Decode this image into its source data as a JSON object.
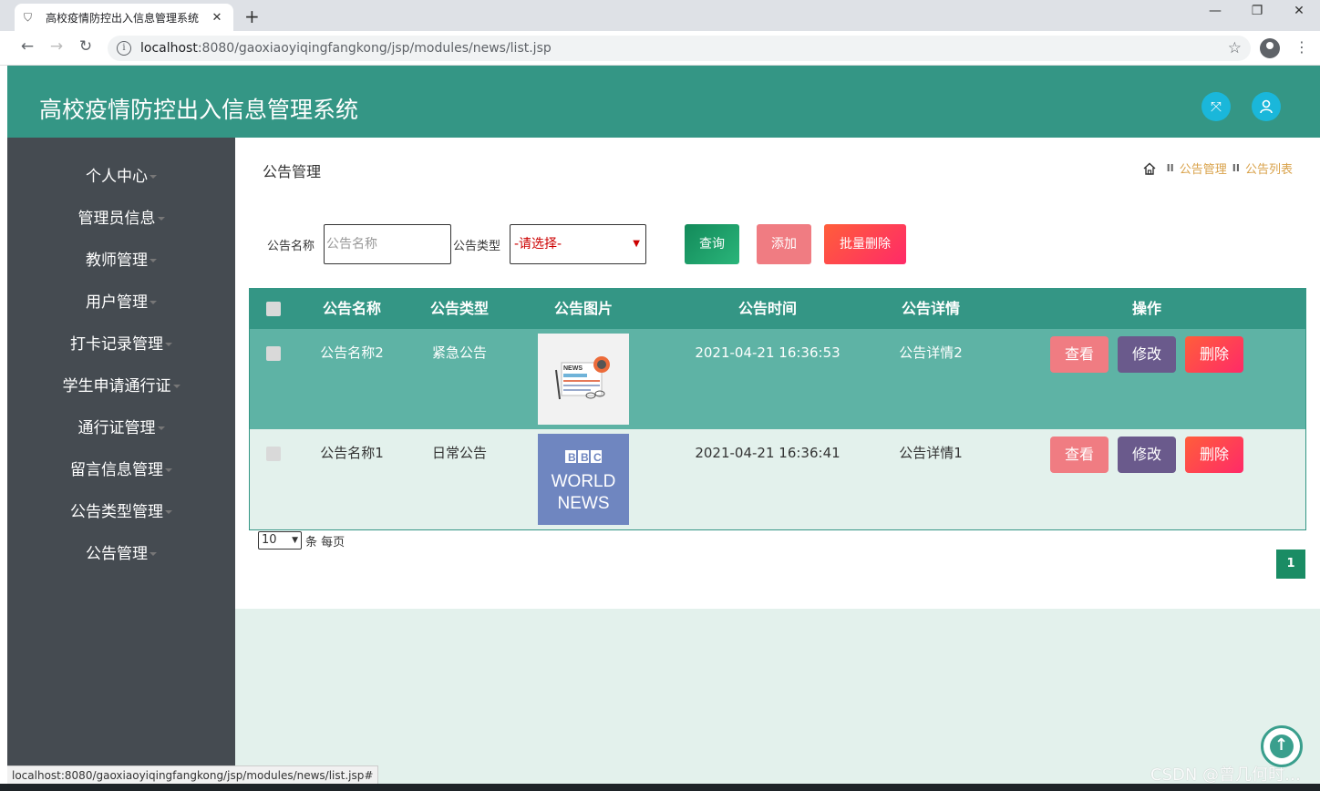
{
  "browser": {
    "tab_title": "高校疫情防控出入信息管理系统",
    "tab_close": "✕",
    "new_tab": "+",
    "url_host": "localhost",
    "url_path": ":8080/gaoxiaoyiqingfangkong/jsp/modules/news/list.jsp",
    "status_url": "localhost:8080/gaoxiaoyiqingfangkong/jsp/modules/news/list.jsp#"
  },
  "header": {
    "title": "高校疫情防控出入信息管理系统"
  },
  "sidebar": {
    "items": [
      {
        "label": "个人中心"
      },
      {
        "label": "管理员信息"
      },
      {
        "label": "教师管理"
      },
      {
        "label": "用户管理"
      },
      {
        "label": "打卡记录管理"
      },
      {
        "label": "学生申请通行证"
      },
      {
        "label": "通行证管理"
      },
      {
        "label": "留言信息管理"
      },
      {
        "label": "公告类型管理"
      },
      {
        "label": "公告管理"
      }
    ]
  },
  "page": {
    "title": "公告管理",
    "breadcrumb": [
      "公告管理",
      "公告列表"
    ],
    "breadcrumb_sep": "II"
  },
  "search": {
    "name_label": "公告名称",
    "name_placeholder": "公告名称",
    "type_label": "公告类型",
    "type_selected": "-请选择-",
    "query_button": "查询",
    "add_button": "添加",
    "batch_delete_button": "批量删除"
  },
  "colors": {
    "header": "#349685",
    "sidebar": "#454b51",
    "query": "#1a9a66",
    "add": "#f07c82",
    "delete": "#ff4b2b",
    "edit": "#6a5a8c",
    "row1": "#5eb3a5"
  },
  "table": {
    "headers": [
      "公告名称",
      "公告类型",
      "公告图片",
      "公告时间",
      "公告详情",
      "操作"
    ],
    "rows": [
      {
        "name": "公告名称2",
        "type": "紧急公告",
        "image": "news-illustration",
        "time": "2021-04-21 16:36:53",
        "detail": "公告详情2"
      },
      {
        "name": "公告名称1",
        "type": "日常公告",
        "image": "bbc-world-news-logo",
        "time": "2021-04-21 16:36:41",
        "detail": "公告详情1"
      }
    ],
    "actions": {
      "view": "查看",
      "edit": "修改",
      "delete": "删除"
    }
  },
  "pagination": {
    "page_size": "10",
    "page_size_suffix": "条 每页",
    "current_page": "1"
  },
  "watermark": "CSDN @曾几何时…"
}
